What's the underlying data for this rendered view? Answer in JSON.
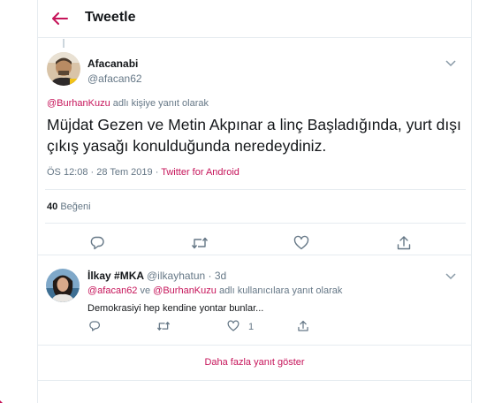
{
  "header": {
    "title": "Tweetle"
  },
  "tweet": {
    "author_name": "Afacanabi",
    "author_handle": "@afacan62",
    "reply_mention": "@BurhanKuzu",
    "reply_suffix": " adlı kişiye yanıt olarak",
    "text": "Müjdat Gezen ve Metin Akpınar a linç Başladığında, yurt dışı çıkış yasağı konulduğunda neredeydiniz.",
    "timestamp": "ÖS 12:08 · 28 Tem 2019 · ",
    "source": "Twitter for Android",
    "likes_count": "40",
    "likes_label": "Beğeni"
  },
  "reply": {
    "author_name": "İlkay #MKA",
    "author_meta": "@ilkayhatun · 3d",
    "mention_1": "@afacan62",
    "between": " ve ",
    "mention_2": "@BurhanKuzu",
    "reply_suffix": " adlı kullanıcılara yanıt olarak",
    "text": "Demokrasiyi hep kendine yontar bunlar...",
    "like_count": "1"
  },
  "more_replies_label": "Daha fazla yanıt göster",
  "colors": {
    "accent": "#c6145a",
    "muted": "#657786",
    "text": "#14171a",
    "border": "#e6ecf0"
  },
  "icons": [
    "back-arrow-icon",
    "chevron-down-icon",
    "reply-icon",
    "retweet-icon",
    "like-icon",
    "share-icon"
  ]
}
